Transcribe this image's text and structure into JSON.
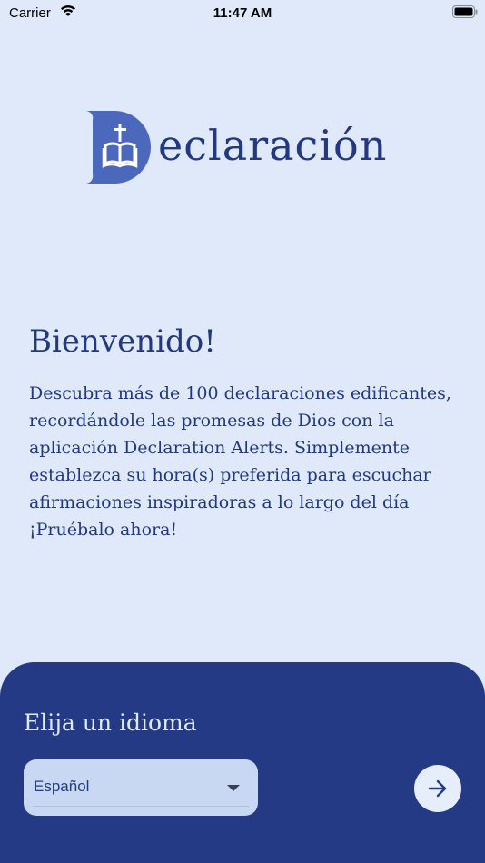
{
  "status_bar": {
    "carrier": "Carrier",
    "time": "11:47 AM"
  },
  "logo": {
    "word_rest": "eclaración",
    "icon": "book-cross-icon",
    "color": "#4b68bd"
  },
  "welcome": {
    "title": "Bienvenido!",
    "body": "Descubra más de 100 declaraciones edificantes, recordándole las promesas de Dios con la aplicación Declaration Alerts. Simplemente establezca su hora(s) preferida para escuchar afirmaciones inspiradoras a lo largo del día ¡Pruébalo ahora!"
  },
  "language": {
    "label": "Elija un idioma",
    "selected": "Español",
    "next_icon": "arrow-right-icon"
  },
  "colors": {
    "background": "#dfe9fa",
    "primary": "#243a85",
    "select_bg": "#c8d8f2"
  }
}
